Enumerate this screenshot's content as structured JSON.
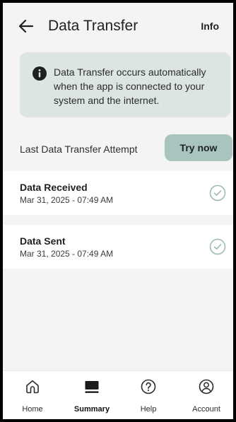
{
  "header": {
    "title": "Data Transfer",
    "info_label": "Info",
    "back_icon": "arrow-left-icon"
  },
  "banner": {
    "icon": "info-icon",
    "text": "Data Transfer occurs automatically when the app is connected to your system and the internet."
  },
  "last_attempt": {
    "label": "Last Data Transfer Attempt",
    "button_label": "Try now"
  },
  "rows": [
    {
      "title": "Data Received",
      "date": "Mar 31, 2025 - 07:49 AM",
      "status_icon": "check-circle-icon"
    },
    {
      "title": "Data Sent",
      "date": "Mar 31, 2025 - 07:49 AM",
      "status_icon": "check-circle-icon"
    }
  ],
  "nav": {
    "items": [
      {
        "label": "Home",
        "icon": "home-icon",
        "active": false
      },
      {
        "label": "Summary",
        "icon": "summary-icon",
        "active": true
      },
      {
        "label": "Help",
        "icon": "help-icon",
        "active": false
      },
      {
        "label": "Account",
        "icon": "account-icon",
        "active": false
      }
    ]
  },
  "colors": {
    "background": "#f3f4f3",
    "banner": "#dde5e1",
    "button": "#a9c4bf",
    "check": "#9bb8b2"
  }
}
